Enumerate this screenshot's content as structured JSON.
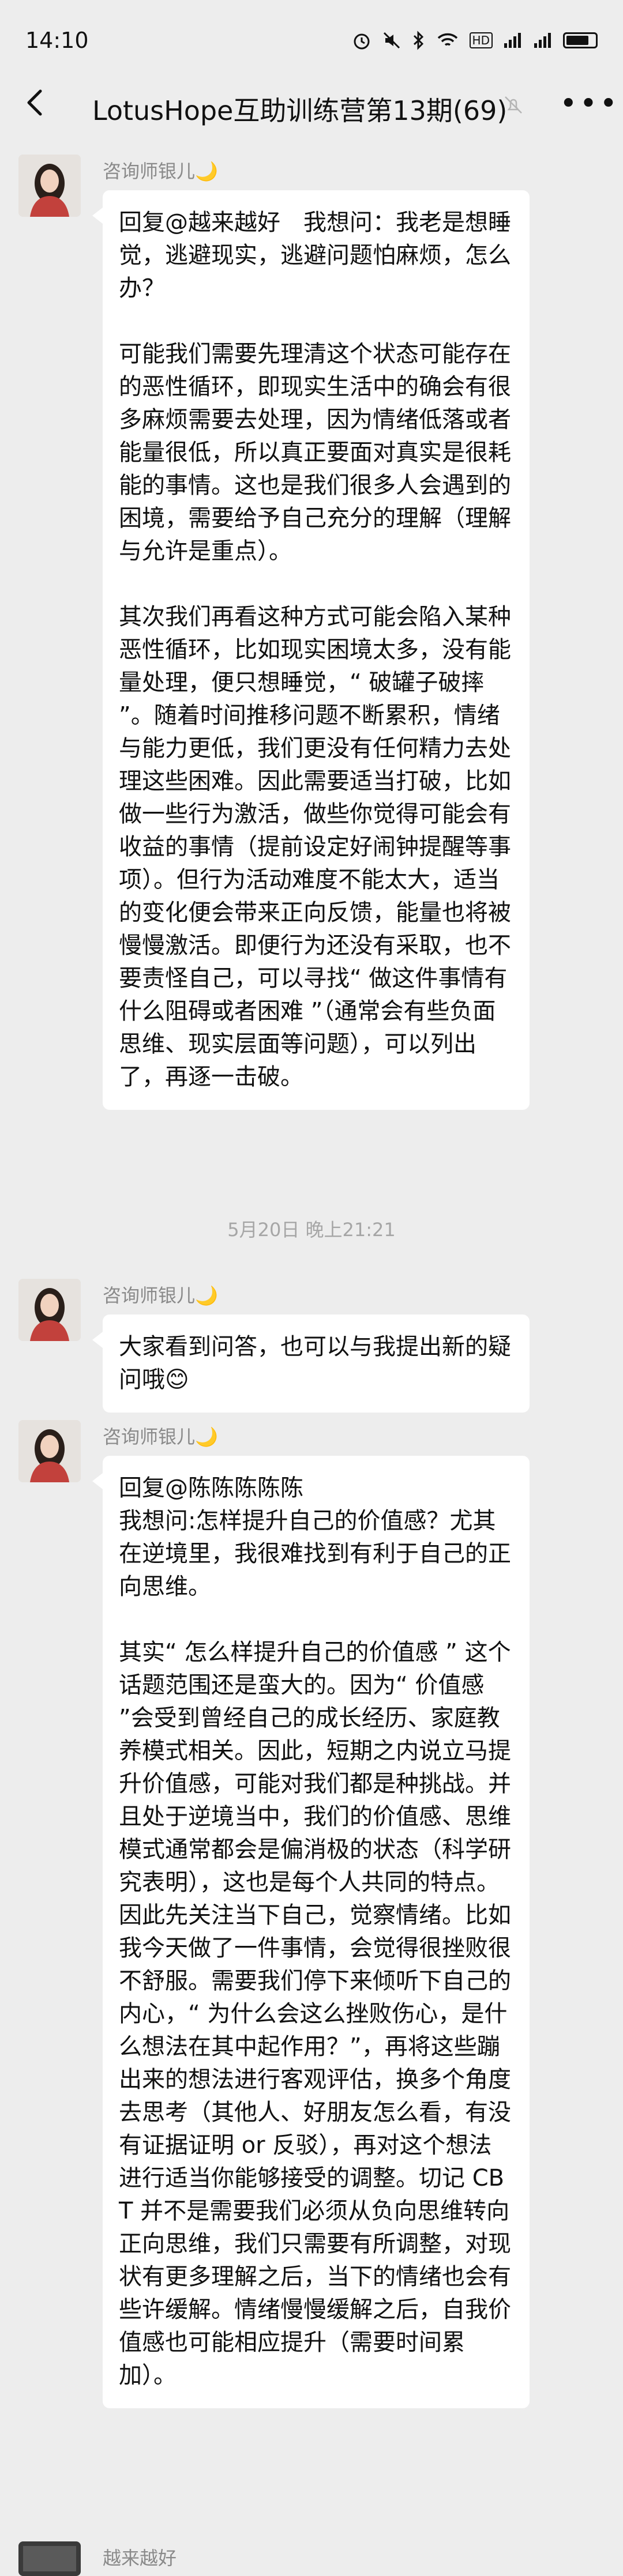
{
  "status": {
    "time": "14:10",
    "icons": [
      "alarm-icon",
      "mute-icon",
      "bluetooth-icon",
      "wifi-icon",
      "hd-icon",
      "signal-icon",
      "signal-icon",
      "battery-icon"
    ],
    "hd_label": "HD"
  },
  "nav": {
    "title": "LotusHope互助训练营第13期(69)",
    "back_icon": "chevron-left-icon",
    "mute_icon": "bell-mute-icon",
    "more_icon": "more-icon"
  },
  "messages": [
    {
      "sender": "咨询师银儿🌙",
      "paragraphs": [
        "回复@越来越好　我想问：我老是想睡觉，逃避现实，逃避问题怕麻烦，怎么办？",
        "可能我们需要先理清这个状态可能存在的恶性循环，即现实生活中的确会有很多麻烦需要去处理，因为情绪低落或者能量很低，所以真正要面对真实是很耗能的事情。这也是我们很多人会遇到的困境，需要给予自己充分的理解（理解与允许是重点）。",
        "其次我们再看这种方式可能会陷入某种恶性循环，比如现实困境太多，没有能量处理，便只想睡觉，“ 破罐子破摔 ”。随着时间推移问题不断累积，情绪与能力更低，我们更没有任何精力去处理这些困难。因此需要适当打破，比如做一些行为激活，做些你觉得可能会有收益的事情（提前设定好闹钟提醒等事项）。但行为活动难度不能太大，适当的变化便会带来正向反馈，能量也将被慢慢激活。即便行为还没有采取，也不要责怪自己，可以寻找“ 做这件事情有什么阻碍或者困难 ”（通常会有些负面思维、现实层面等问题），可以列出了，再逐一击破。"
      ]
    },
    {
      "sender": "咨询师银儿🌙",
      "paragraphs": [
        "大家看到问答，也可以与我提出新的疑问哦😊"
      ]
    },
    {
      "sender": "咨询师银儿🌙",
      "paragraphs": [
        "回复@陈陈陈陈陈\n我想问:怎样提升自己的价值感？尤其在逆境里，我很难找到有利于自己的正向思维。",
        "其实“ 怎么样提升自己的价值感 ” 这个话题范围还是蛮大的。因为“ 价值感 ”会受到曾经自己的成长经历、家庭教养模式相关。因此，短期之内说立马提升价值感，可能对我们都是种挑战。并且处于逆境当中，我们的价值感、思维模式通常都会是偏消极的状态（科学研究表明），这也是每个人共同的特点。因此先关注当下自己，觉察情绪。比如我今天做了一件事情，会觉得很挫败很不舒服。需要我们停下来倾听下自己的内心，“ 为什么会这么挫败伤心，是什么想法在其中起作用？”，再将这些蹦出来的想法进行客观评估，换多个角度去思考（其他人、好朋友怎么看，有没有证据证明 or 反驳），再对这个想法进行适当你能够接受的调整。切记 CBT 并不是需要我们必须从负向思维转向正向思维，我们只需要有所调整，对现状有更多理解之后，当下的情绪也会有些许缓解。情绪慢慢缓解之后，自我价值感也可能相应提升（需要时间累加）。"
      ]
    },
    {
      "sender": "越来越好",
      "paragraphs": []
    }
  ],
  "time_separator": "5月20日 晚上21:21"
}
